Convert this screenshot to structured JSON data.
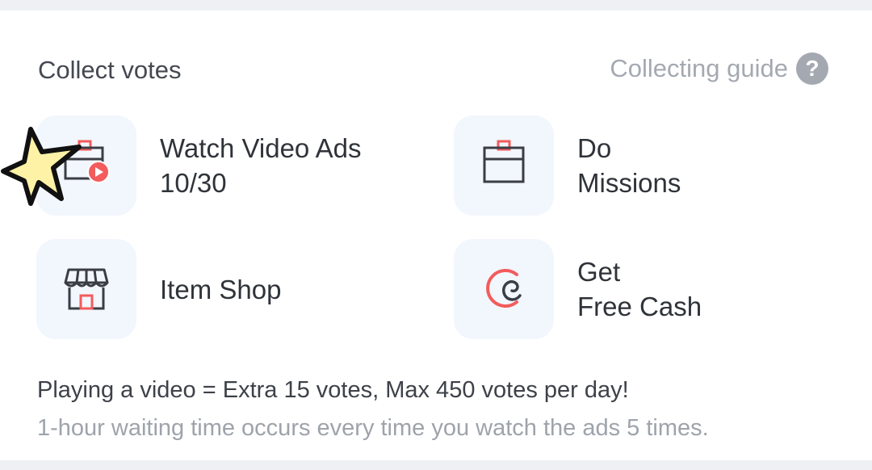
{
  "section": {
    "title": "Collect votes",
    "guide_label": "Collecting guide",
    "guide_icon": "question-circle-icon"
  },
  "options": [
    {
      "line1": "Watch Video Ads",
      "line2": "10/30",
      "icon": "video-ad-calendar-icon"
    },
    {
      "line1": "Do",
      "line2": "Missions",
      "icon": "calendar-icon"
    },
    {
      "line1": "Item Shop",
      "line2": "",
      "icon": "storefront-icon"
    },
    {
      "line1": "Get",
      "line2": "Free Cash",
      "icon": "cash-coin-icon"
    }
  ],
  "notice": {
    "main": "Playing a video = Extra 15 votes, Max 450 votes per day!",
    "sub": "1-hour waiting time occurs every time you watch the ads 5 times."
  },
  "colors": {
    "accent": "#f25c5c",
    "tile_bg": "#f2f6fd",
    "icon_dark": "#3a3d44",
    "star_fill": "#fdf2a6"
  }
}
